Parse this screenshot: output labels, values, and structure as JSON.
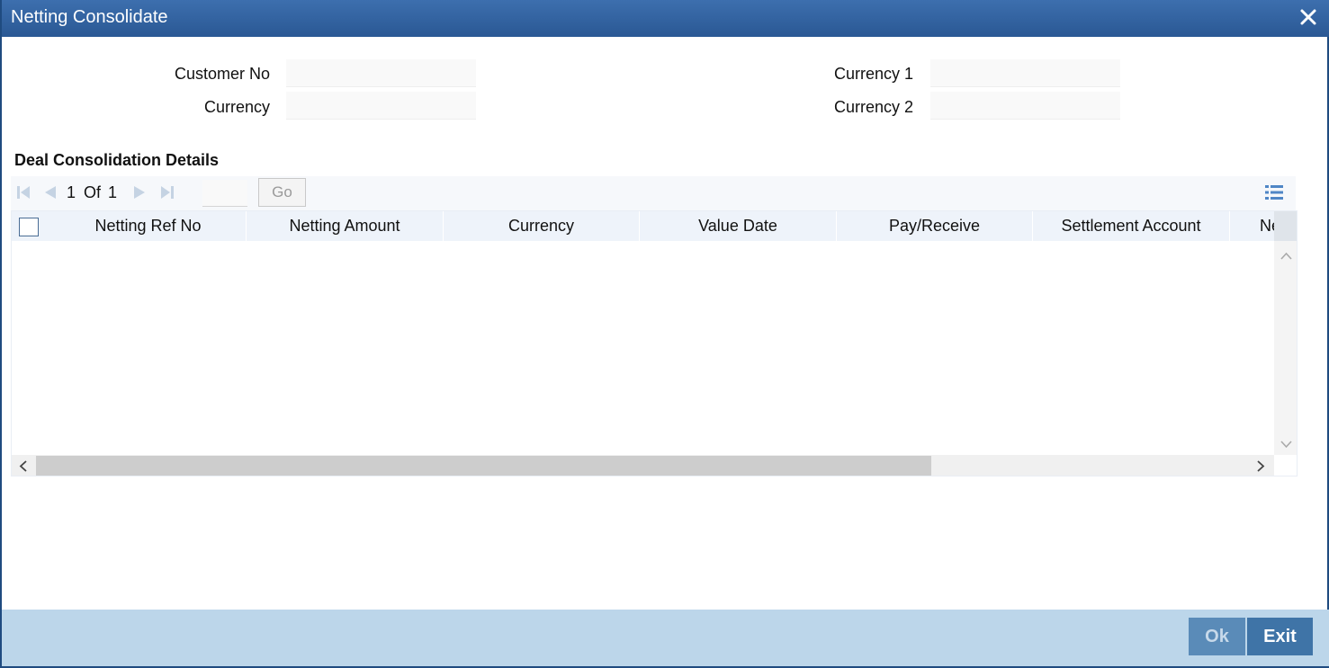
{
  "window": {
    "title": "Netting Consolidate"
  },
  "form": {
    "customer_no_label": "Customer No",
    "customer_no_value": "",
    "currency_label": "Currency",
    "currency_value": "",
    "currency1_label": "Currency 1",
    "currency1_value": "",
    "currency2_label": "Currency 2",
    "currency2_value": ""
  },
  "section": {
    "title": "Deal Consolidation Details"
  },
  "pager": {
    "current": "1",
    "of_label": "Of",
    "total": "1",
    "go_label": "Go",
    "page_input": ""
  },
  "grid": {
    "columns": [
      "Netting Ref No",
      "Netting Amount",
      "Currency",
      "Value Date",
      "Pay/Receive",
      "Settlement Account",
      "Ne"
    ],
    "rows": []
  },
  "footer": {
    "ok_label": "Ok",
    "exit_label": "Exit"
  },
  "colors": {
    "titlebar": "#2a5894",
    "footer": "#bcd6ea",
    "button": "#3f74a7",
    "grid_header": "#eef3fa"
  }
}
